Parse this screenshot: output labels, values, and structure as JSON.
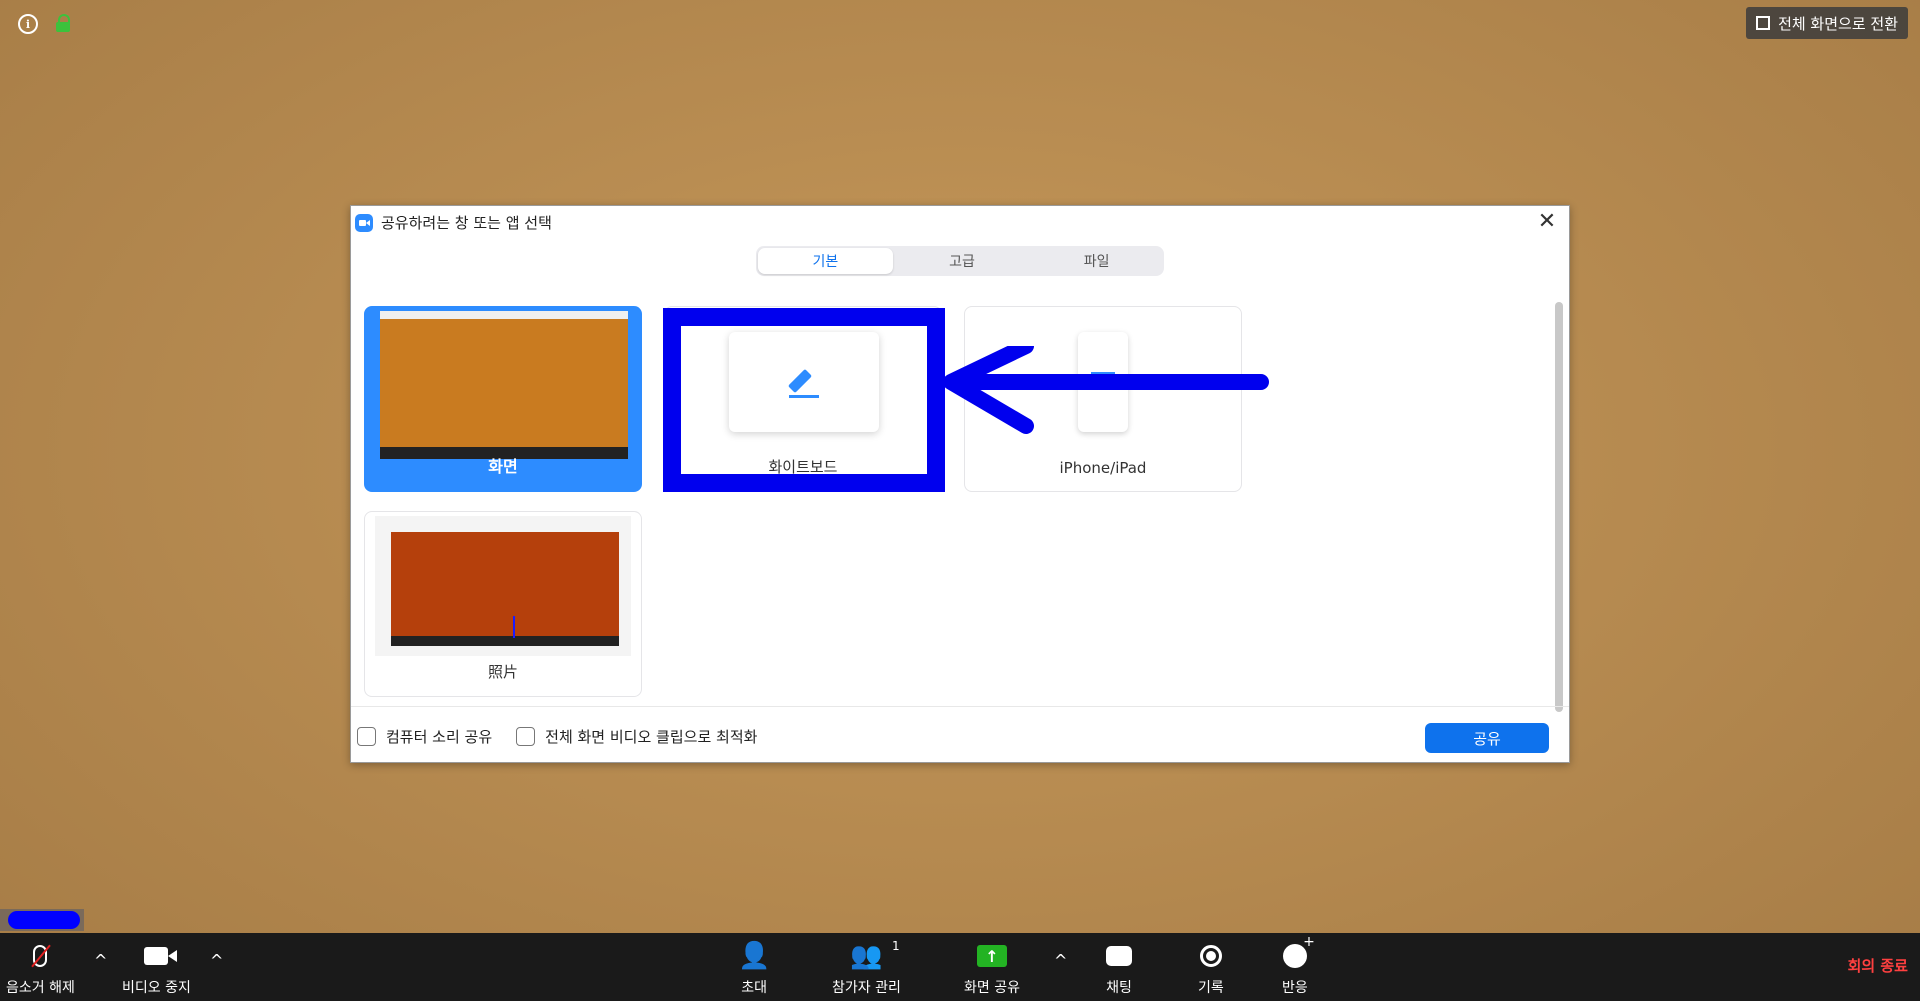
{
  "window": {
    "fullscreen_label": "전체 화면으로 전환"
  },
  "dialog": {
    "title": "공유하려는 창 또는 앱 선택",
    "tabs": [
      {
        "label": "기본"
      },
      {
        "label": "고급"
      },
      {
        "label": "파일"
      }
    ],
    "cards": [
      {
        "label": "화면"
      },
      {
        "label": "화이트보드"
      },
      {
        "label": "iPhone/iPad"
      },
      {
        "label": "照片"
      }
    ],
    "share_sound_label": "컴퓨터 소리 공유",
    "optimize_video_label": "전체 화면 비디오 클립으로 최적화",
    "share_button": "공유"
  },
  "toolbar": {
    "unmute": "음소거 해제",
    "stop_video": "비디오 중지",
    "invite": "초대",
    "participants": "참가자 관리",
    "participants_count": "1",
    "share_screen": "화면 공유",
    "chat": "채팅",
    "record": "기록",
    "reactions": "반응",
    "end_meeting": "회의 종료"
  },
  "colors": {
    "accent": "#0e72ed",
    "share_green": "#23b323",
    "end_red": "#ff4040",
    "annotation_blue": "#0000ee"
  }
}
